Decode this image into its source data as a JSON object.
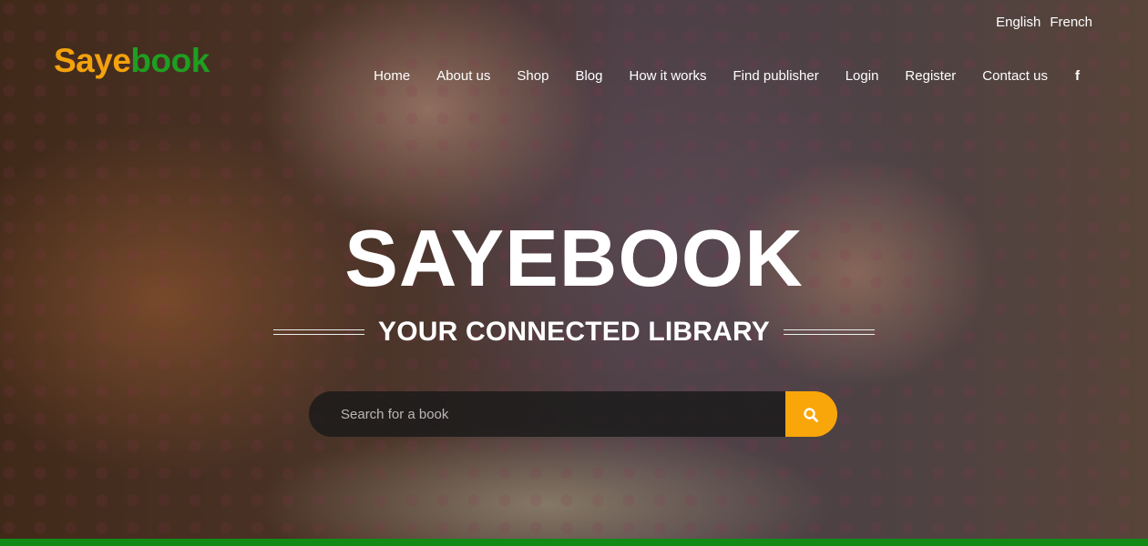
{
  "language": {
    "options": [
      "English",
      "French"
    ]
  },
  "logo": {
    "part1": "Saye",
    "part2": "book"
  },
  "nav": {
    "items": [
      "Home",
      "About us",
      "Shop",
      "Blog",
      "How it works",
      "Find publisher",
      "Login",
      "Register",
      "Contact us"
    ],
    "social_icon": "facebook-icon",
    "social_glyph": "f"
  },
  "hero": {
    "title": "SAYEBOOK",
    "tagline": "YOUR CONNECTED LIBRARY"
  },
  "search": {
    "placeholder": "Search for a book",
    "button_icon": "search-icon"
  },
  "colors": {
    "accent": "#f9a60b",
    "brand_green": "#1f9e21",
    "bottom_bar": "#148a16"
  }
}
